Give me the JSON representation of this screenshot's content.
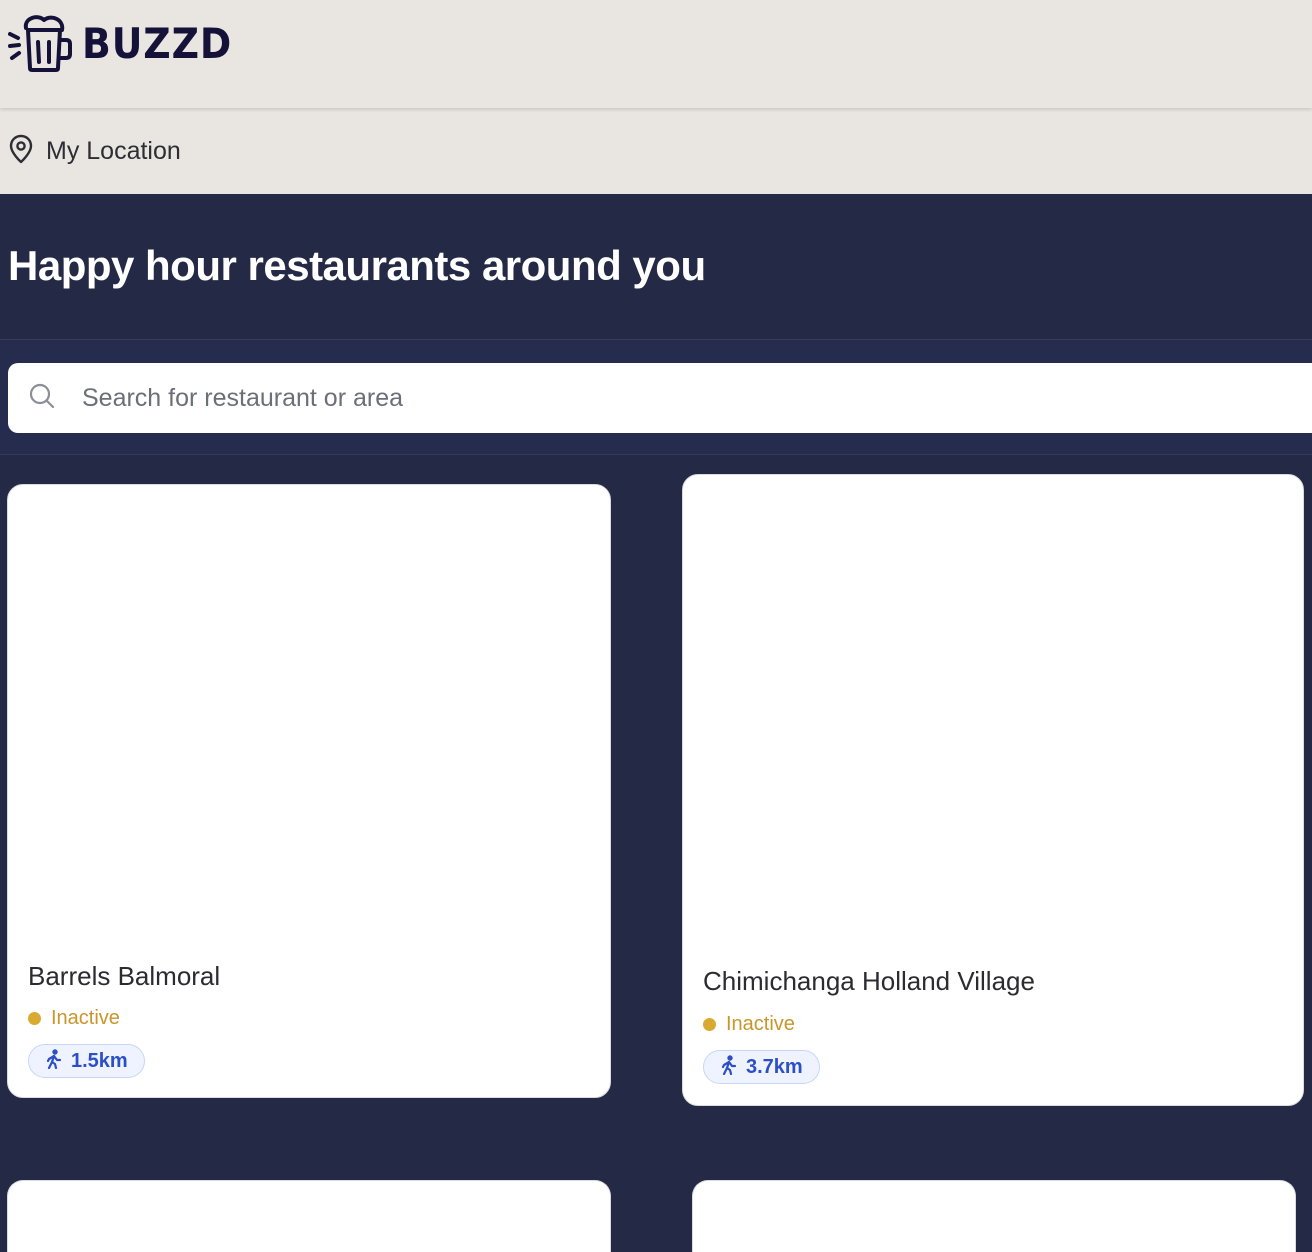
{
  "app": {
    "brand_name": "BUZZD",
    "colors": {
      "header_bg": "#e9e6e1",
      "page_bg": "#242946",
      "brand": "#15123a",
      "status_inactive": "#d9aa32",
      "distance_accent": "#2d4fc6"
    }
  },
  "location": {
    "icon": "map-pin-icon",
    "label": "My Location"
  },
  "hero": {
    "title": "Happy hour restaurants around you"
  },
  "search": {
    "icon": "search-icon",
    "placeholder": "Search for restaurant or area",
    "value": ""
  },
  "restaurants": [
    {
      "name": "Barrels Balmoral",
      "status": "Inactive",
      "distance": "1.5km",
      "distance_icon": "walking-person-icon"
    },
    {
      "name": "Chimichanga Holland Village",
      "status": "Inactive",
      "distance": "3.7km",
      "distance_icon": "walking-person-icon"
    }
  ]
}
